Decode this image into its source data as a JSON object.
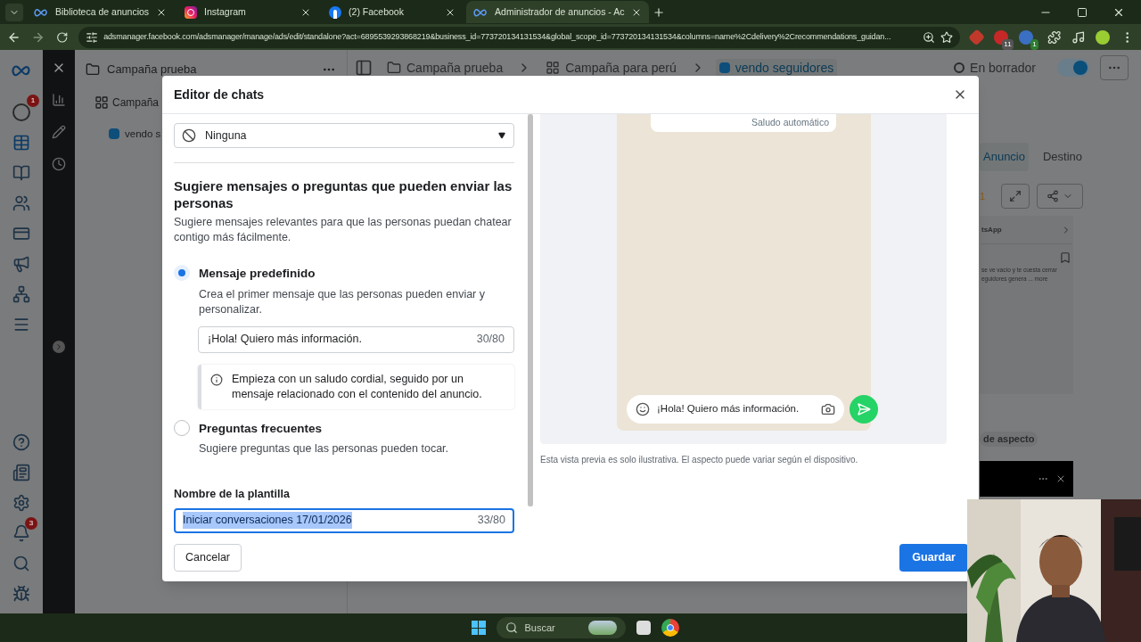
{
  "browser": {
    "tabs": [
      {
        "title": "Biblioteca de anuncios",
        "kind": "meta",
        "selected": false
      },
      {
        "title": "Instagram",
        "kind": "instagram",
        "selected": false
      },
      {
        "title": "(2) Facebook",
        "kind": "facebook",
        "selected": false
      },
      {
        "title": "Administrador de anuncios - Ac",
        "kind": "meta",
        "selected": true
      }
    ],
    "url": "adsmanager.facebook.com/adsmanager/manage/ads/edit/standalone?act=6895539293868219&business_id=773720134131534&global_scope_id=773720134131534&columns=name%2Cdelivery%2Crecommendations_guidan...",
    "extension_badges": [
      "11",
      "1"
    ]
  },
  "app": {
    "rail_badges": [
      "1",
      "3"
    ],
    "tree": [
      {
        "label": "Campaña prueba",
        "kind": "folder"
      },
      {
        "label": "Campaña",
        "kind": "grid"
      },
      {
        "label": "vendo s",
        "kind": "ad"
      }
    ],
    "breadcrumbs": [
      {
        "label": "Campaña prueba",
        "kind": "folder",
        "selected": false
      },
      {
        "label": "Campaña para perú",
        "kind": "grid",
        "selected": false
      },
      {
        "label": "vendo seguidores",
        "kind": "ad",
        "selected": true
      }
    ],
    "status": "En borrador",
    "toggle_on": true,
    "tabs": [
      {
        "label": "Anuncio",
        "selected": true
      },
      {
        "label": "Destino",
        "selected": false
      }
    ],
    "issue_count": "1",
    "preview_title": "tsApp",
    "preview_text": "se ve vacío y te cuesta cerrar",
    "preview_text_2": "eguidores genera ... more",
    "aspect_chip": "de aspecto"
  },
  "modal": {
    "title": "Editor de chats",
    "cta_value": "Ninguna",
    "section_title": "Sugiere mensajes o preguntas que pueden enviar las personas",
    "section_description": "Sugiere mensajes relevantes para que las personas puedan chatear contigo más fácilmente.",
    "options": [
      {
        "label": "Mensaje predefinido",
        "description": "Crea el primer mensaje que las personas pueden enviar y personalizar.",
        "selected": true
      },
      {
        "label": "Preguntas frecuentes",
        "description": "Sugiere preguntas que las personas pueden tocar.",
        "selected": false
      }
    ],
    "message_value": "¡Hola! Quiero más información.",
    "message_count": "30/80",
    "tip": "Empieza con un saludo cordial, seguido por un mensaje relacionado con el contenido del anuncio.",
    "template_label": "Nombre de la plantilla",
    "template_value": "Iniciar conversaciones 17/01/2026",
    "template_count": "33/80",
    "preview": {
      "greeting_label": "Saludo automático",
      "composer_text": "¡Hola! Quiero más información.",
      "note": "Esta vista previa es solo ilustrativa. El aspecto puede variar según el dispositivo."
    },
    "buttons": {
      "cancel": "Cancelar",
      "save": "Guardar"
    }
  },
  "taskbar": {
    "search_placeholder": "Buscar"
  }
}
